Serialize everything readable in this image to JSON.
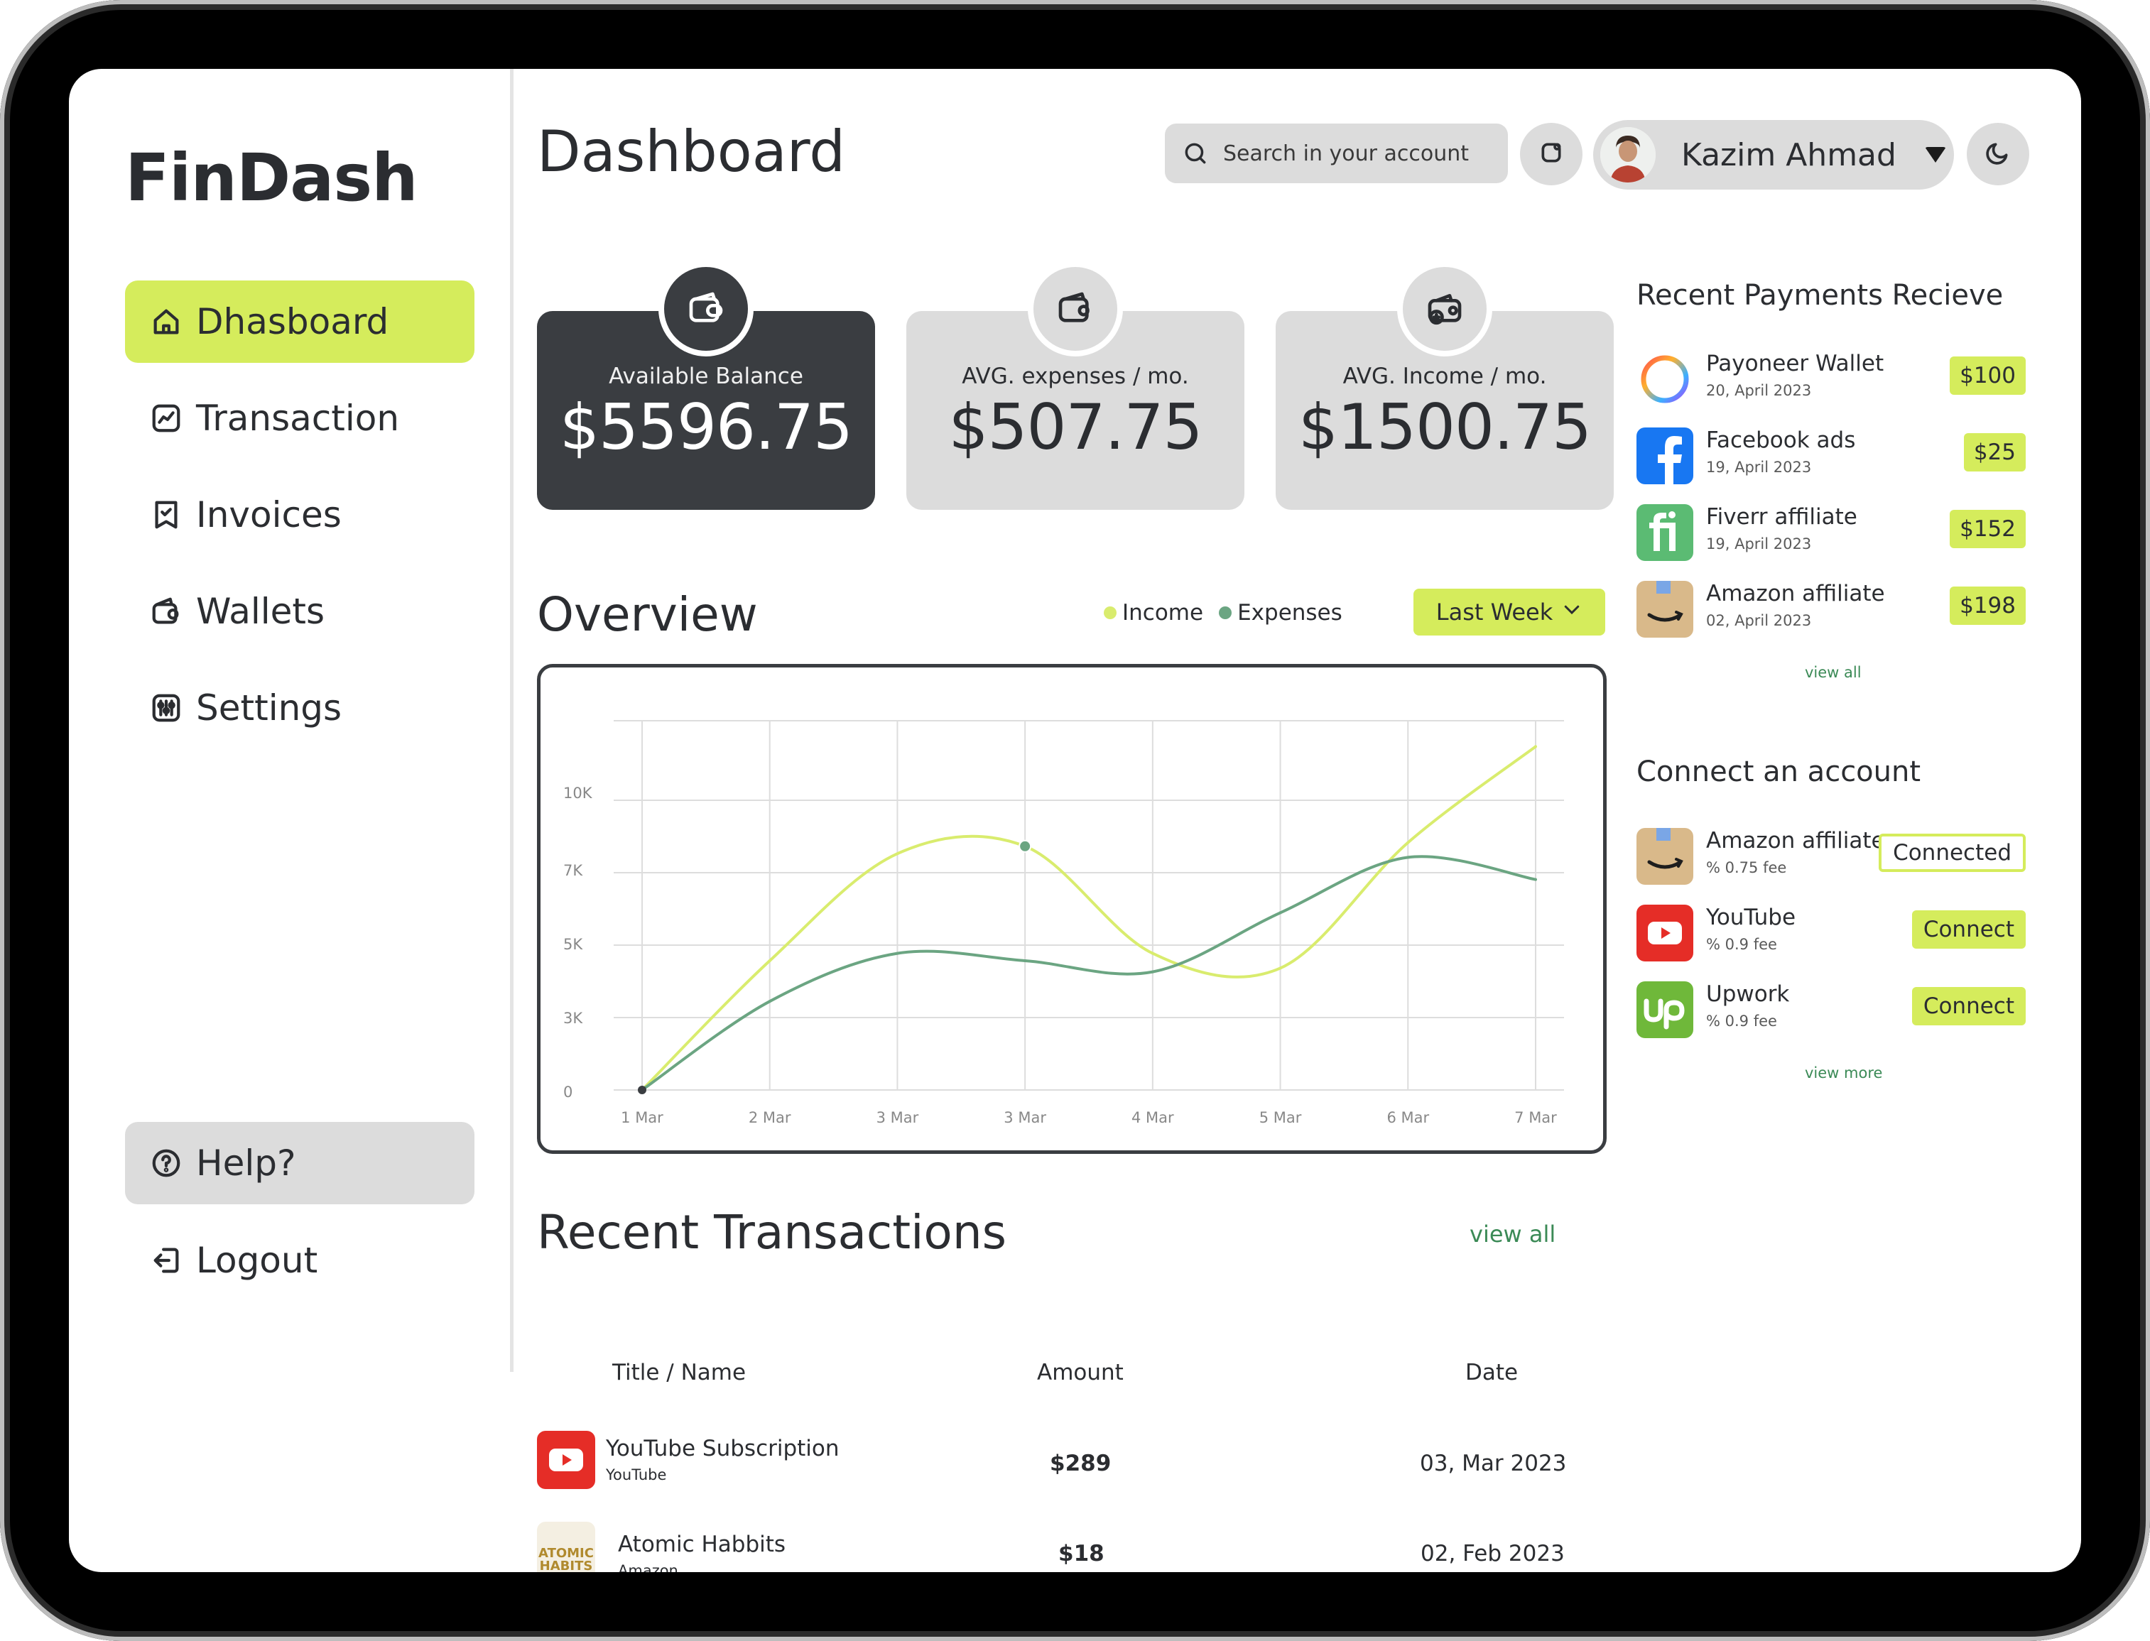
{
  "app": {
    "logo": "FinDash"
  },
  "sidebar": {
    "items": [
      {
        "label": "Dhasboard",
        "icon": "home-icon",
        "active": true
      },
      {
        "label": "Transaction",
        "icon": "chart-icon"
      },
      {
        "label": "Invoices",
        "icon": "invoice-icon"
      },
      {
        "label": "Wallets",
        "icon": "wallet-icon"
      },
      {
        "label": "Settings",
        "icon": "sliders-icon"
      }
    ],
    "help": "Help?",
    "logout": "Logout"
  },
  "header": {
    "title": "Dashboard",
    "search_placeholder": "Search in your account",
    "user_name": "Kazim Ahmad"
  },
  "stats": [
    {
      "label": "Available Balance",
      "value": "$5596.75"
    },
    {
      "label": "AVG. expenses / mo.",
      "value": "$507.75"
    },
    {
      "label": "AVG. Income / mo.",
      "value": "$1500.75"
    }
  ],
  "overview": {
    "title": "Overview",
    "legend_income": "Income",
    "legend_expenses": "Expenses",
    "range": "Last Week"
  },
  "colors": {
    "accent": "#d5ec5c",
    "income": "#d9ec6e",
    "expenses": "#6ba582",
    "dark": "#3a3d41",
    "link": "#3b8a56"
  },
  "chart_data": {
    "type": "line",
    "categories": [
      "1 Mar",
      "2 Mar",
      "3 Mar",
      "3 Mar",
      "4 Mar",
      "5 Mar",
      "6 Mar",
      "7 Mar"
    ],
    "y_ticks": [
      "0",
      "3K",
      "5K",
      "7K",
      "10K"
    ],
    "ylim": [
      0,
      10000
    ],
    "grid": true,
    "series": [
      {
        "name": "Income",
        "values": [
          0,
          3500,
          6400,
          6600,
          3700,
          3300,
          6700,
          9300
        ]
      },
      {
        "name": "Expenses",
        "values": [
          0,
          2400,
          3700,
          3500,
          3200,
          4800,
          6300,
          5700
        ]
      }
    ]
  },
  "recent_payments": {
    "title": "Recent Payments Recieve",
    "items": [
      {
        "name": "Payoneer Wallet",
        "date": "20, April 2023",
        "amount": "$100",
        "icon": "payoneer-icon"
      },
      {
        "name": "Facebook ads",
        "date": "19, April 2023",
        "amount": "$25",
        "icon": "facebook-icon"
      },
      {
        "name": "Fiverr affiliate",
        "date": "19, April 2023",
        "amount": "$152",
        "icon": "fiverr-icon"
      },
      {
        "name": "Amazon affiliate",
        "date": "02, April 2023",
        "amount": "$198",
        "icon": "amazon-icon"
      }
    ],
    "view_all": "view all"
  },
  "connect": {
    "title": "Connect an account",
    "items": [
      {
        "name": "Amazon affiliate",
        "fee": "% 0.75 fee",
        "action": "Connected",
        "icon": "amazon-icon"
      },
      {
        "name": "YouTube",
        "fee": "% 0.9 fee",
        "action": "Connect",
        "icon": "youtube-icon"
      },
      {
        "name": "Upwork",
        "fee": "% 0.9 fee",
        "action": "Connect",
        "icon": "upwork-icon"
      }
    ],
    "view_more": "view more"
  },
  "transactions": {
    "title": "Recent Transactions",
    "view_all": "view all",
    "columns": [
      "Title / Name",
      "Amount",
      "Date"
    ],
    "rows": [
      {
        "name": "YouTube Subscription",
        "source": "YouTube",
        "amount": "$289",
        "date": "03, Mar 2023",
        "icon": "youtube-icon"
      },
      {
        "name": "Atomic Habbits",
        "source": "Amazon",
        "amount": "$18",
        "date": "02, Feb 2023",
        "icon": "book-cover-icon",
        "cover_text": "ATOMIC HABITS"
      }
    ]
  }
}
